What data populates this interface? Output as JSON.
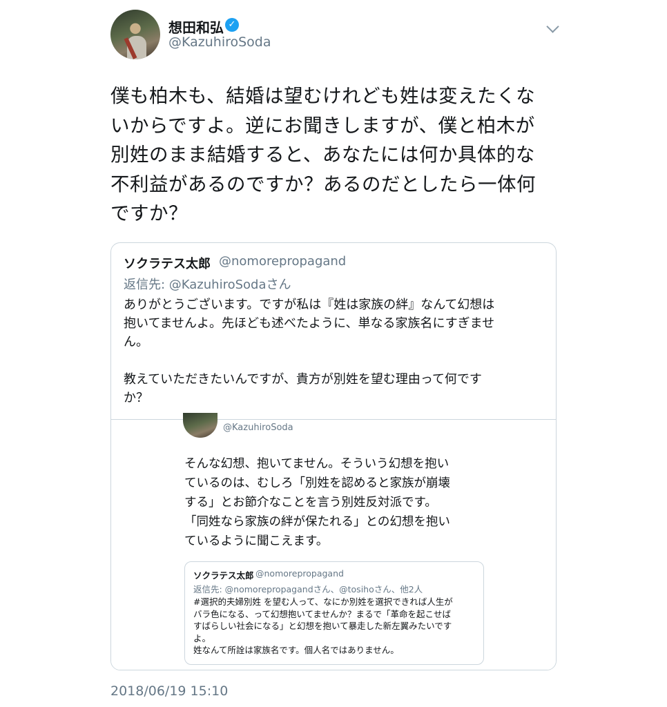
{
  "tweet": {
    "display_name": "想田和弘",
    "verified_icon": "verified-check-icon",
    "handle": "@KazuhiroSoda",
    "menu_icon": "chevron-down-icon",
    "text": "僕も柏木も、結婚は望むけれども姓は変えたくな\nいからですよ。逆にお聞きしますが、僕と柏木が\n別姓のまま結婚すると、あなたには何か具体的な\n不利益があるのですか？あるのだとしたら一体何\nですか？",
    "timestamp": "2018/06/19 15:10"
  },
  "quoted": {
    "display_name": "ソクラテス太郎",
    "handle": "@nomorepropagand",
    "reply_to": "返信先: @KazuhiroSodaさん",
    "text": "ありがとうございます。ですが私は『姓は家族の絆』なんて幻想は\n抱いてませんよ。先ほども述べたように、単なる家族名にすぎませ\nん。\n\n教えていただきたいんですが、貴方が別姓を望む理由って何です\nか？",
    "embedded": {
      "handle": "@KazuhiroSoda",
      "text": "そんな幻想、抱いてません。そういう幻想を抱い\nているのは、むしろ「別姓を認めると家族が崩壊\nする」とお節介なことを言う別姓反対派です。\n「同姓なら家族の絆が保たれる」との幻想を抱い\nているように聞こえます。",
      "inner": {
        "display_name": "ソクラテス太郎",
        "handle": "@nomorepropagand",
        "reply_to": "返信先: @nomorepropagandさん、@tosihoさん、他2人",
        "text": "#選択的夫婦別姓 を望む人って、なにか別姓を選択できれば人生が\nバラ色になる、って幻想抱いてませんか？まるで「革命を起こせば\nすばらしい社会になる」と幻想を抱いて暴走した新左翼みたいです\nよ。\n姓なんて所詮は家族名です。個人名ではありません。"
      }
    }
  },
  "colors": {
    "text": "#14171a",
    "secondary": "#657786",
    "border": "#ccd6dd",
    "verified": "#1da1f2"
  }
}
